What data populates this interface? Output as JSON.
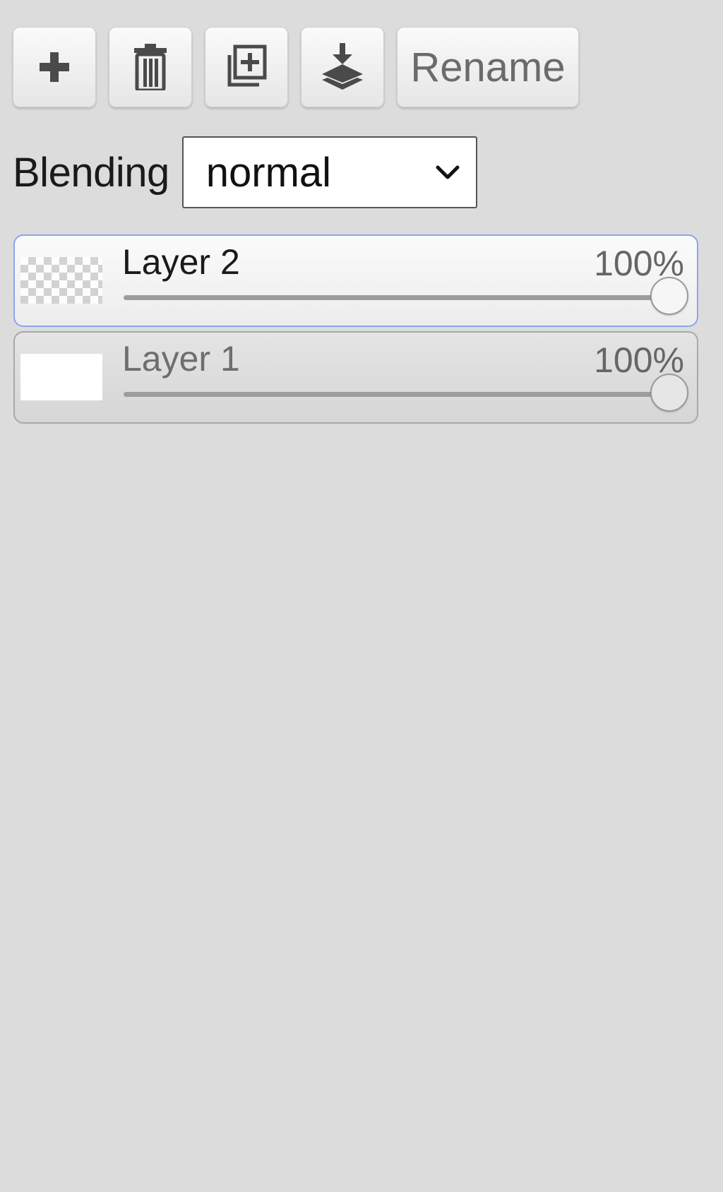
{
  "toolbar": {
    "buttons": [
      {
        "icon": "plus-icon"
      },
      {
        "icon": "trash-icon"
      },
      {
        "icon": "duplicate-layer-icon"
      },
      {
        "icon": "merge-down-icon"
      }
    ],
    "rename_label": "Rename"
  },
  "blending": {
    "label": "Blending",
    "selected": "normal"
  },
  "layers": [
    {
      "name": "Layer 2",
      "opacity_text": "100%",
      "opacity": 1.0,
      "selected": true,
      "thumbnail": "transparent-checker"
    },
    {
      "name": "Layer 1",
      "opacity_text": "100%",
      "opacity": 1.0,
      "selected": false,
      "thumbnail": "white"
    }
  ],
  "colors": {
    "background": "#dcdcdc",
    "selected_border": "#8aa6f0"
  }
}
